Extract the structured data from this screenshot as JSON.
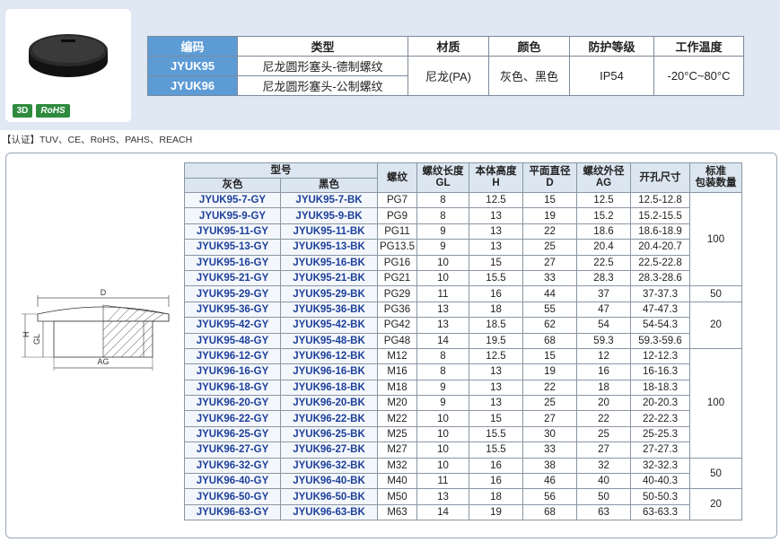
{
  "badges": {
    "three_d": "3D",
    "rohs": "RoHS"
  },
  "spec_table": {
    "headers": [
      "编码",
      "类型",
      "材质",
      "颜色",
      "防护等级",
      "工作温度"
    ],
    "rows": [
      {
        "code": "JYUK95",
        "type": "尼龙圆形塞头-德制螺纹"
      },
      {
        "code": "JYUK96",
        "type": "尼龙圆形塞头-公制螺纹"
      }
    ],
    "material": "尼龙(PA)",
    "color": "灰色、黑色",
    "protection": "IP54",
    "temperature": "-20°C~80°C"
  },
  "certification": "【认证】TUV、CE、RoHS、PAHS、REACH",
  "drawing_labels": {
    "d": "D",
    "h": "H",
    "gl": "GL",
    "ag": "AG"
  },
  "main_table": {
    "header_model": "型号",
    "header_gray": "灰色",
    "header_black": "黑色",
    "header_thread": "螺纹",
    "header_gl": [
      "螺纹长度",
      "GL"
    ],
    "header_h": [
      "本体高度",
      "H"
    ],
    "header_d": [
      "平面直径",
      "D"
    ],
    "header_ag": [
      "螺纹外径",
      "AG"
    ],
    "header_hole": "开孔尺寸",
    "header_pack": [
      "标准",
      "包装数量"
    ],
    "rows": [
      [
        "JYUK95-7-GY",
        "JYUK95-7-BK",
        "PG7",
        "8",
        "12.5",
        "15",
        "12.5",
        "12.5-12.8"
      ],
      [
        "JYUK95-9-GY",
        "JYUK95-9-BK",
        "PG9",
        "8",
        "13",
        "19",
        "15.2",
        "15.2-15.5"
      ],
      [
        "JYUK95-11-GY",
        "JYUK95-11-BK",
        "PG11",
        "9",
        "13",
        "22",
        "18.6",
        "18.6-18.9"
      ],
      [
        "JYUK95-13-GY",
        "JYUK95-13-BK",
        "PG13.5",
        "9",
        "13",
        "25",
        "20.4",
        "20.4-20.7"
      ],
      [
        "JYUK95-16-GY",
        "JYUK95-16-BK",
        "PG16",
        "10",
        "15",
        "27",
        "22.5",
        "22.5-22.8"
      ],
      [
        "JYUK95-21-GY",
        "JYUK95-21-BK",
        "PG21",
        "10",
        "15.5",
        "33",
        "28.3",
        "28.3-28.6"
      ],
      [
        "JYUK95-29-GY",
        "JYUK95-29-BK",
        "PG29",
        "11",
        "16",
        "44",
        "37",
        "37-37.3"
      ],
      [
        "JYUK95-36-GY",
        "JYUK95-36-BK",
        "PG36",
        "13",
        "18",
        "55",
        "47",
        "47-47.3"
      ],
      [
        "JYUK95-42-GY",
        "JYUK95-42-BK",
        "PG42",
        "13",
        "18.5",
        "62",
        "54",
        "54-54.3"
      ],
      [
        "JYUK95-48-GY",
        "JYUK95-48-BK",
        "PG48",
        "14",
        "19.5",
        "68",
        "59.3",
        "59.3-59.6"
      ],
      [
        "JYUK96-12-GY",
        "JYUK96-12-BK",
        "M12",
        "8",
        "12.5",
        "15",
        "12",
        "12-12.3"
      ],
      [
        "JYUK96-16-GY",
        "JYUK96-16-BK",
        "M16",
        "8",
        "13",
        "19",
        "16",
        "16-16.3"
      ],
      [
        "JYUK96-18-GY",
        "JYUK96-18-BK",
        "M18",
        "9",
        "13",
        "22",
        "18",
        "18-18.3"
      ],
      [
        "JYUK96-20-GY",
        "JYUK96-20-BK",
        "M20",
        "9",
        "13",
        "25",
        "20",
        "20-20.3"
      ],
      [
        "JYUK96-22-GY",
        "JYUK96-22-BK",
        "M22",
        "10",
        "15",
        "27",
        "22",
        "22-22.3"
      ],
      [
        "JYUK96-25-GY",
        "JYUK96-25-BK",
        "M25",
        "10",
        "15.5",
        "30",
        "25",
        "25-25.3"
      ],
      [
        "JYUK96-27-GY",
        "JYUK96-27-BK",
        "M27",
        "10",
        "15.5",
        "33",
        "27",
        "27-27.3"
      ],
      [
        "JYUK96-32-GY",
        "JYUK96-32-BK",
        "M32",
        "10",
        "16",
        "38",
        "32",
        "32-32.3"
      ],
      [
        "JYUK96-40-GY",
        "JYUK96-40-BK",
        "M40",
        "11",
        "16",
        "46",
        "40",
        "40-40.3"
      ],
      [
        "JYUK96-50-GY",
        "JYUK96-50-BK",
        "M50",
        "13",
        "18",
        "56",
        "50",
        "50-50.3"
      ],
      [
        "JYUK96-63-GY",
        "JYUK96-63-BK",
        "M63",
        "14",
        "19",
        "68",
        "63",
        "63-63.3"
      ]
    ],
    "pack_groups": [
      {
        "start": 0,
        "span": 6,
        "value": "100"
      },
      {
        "start": 6,
        "span": 1,
        "value": "50"
      },
      {
        "start": 7,
        "span": 3,
        "value": "20"
      },
      {
        "start": 10,
        "span": 7,
        "value": "100"
      },
      {
        "start": 17,
        "span": 2,
        "value": "50"
      },
      {
        "start": 19,
        "span": 2,
        "value": "20"
      }
    ]
  },
  "colors": {
    "code_blue": "#5d9bd5",
    "model_text": "#1d3f9a",
    "band": "#dfe8f3"
  }
}
